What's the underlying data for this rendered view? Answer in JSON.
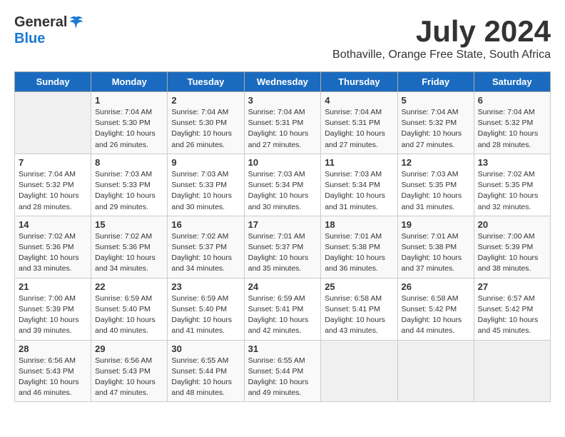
{
  "logo": {
    "general": "General",
    "blue": "Blue"
  },
  "title": "July 2024",
  "subtitle": "Bothaville, Orange Free State, South Africa",
  "days_of_week": [
    "Sunday",
    "Monday",
    "Tuesday",
    "Wednesday",
    "Thursday",
    "Friday",
    "Saturday"
  ],
  "weeks": [
    [
      {
        "day": "",
        "info": ""
      },
      {
        "day": "1",
        "info": "Sunrise: 7:04 AM\nSunset: 5:30 PM\nDaylight: 10 hours\nand 26 minutes."
      },
      {
        "day": "2",
        "info": "Sunrise: 7:04 AM\nSunset: 5:30 PM\nDaylight: 10 hours\nand 26 minutes."
      },
      {
        "day": "3",
        "info": "Sunrise: 7:04 AM\nSunset: 5:31 PM\nDaylight: 10 hours\nand 27 minutes."
      },
      {
        "day": "4",
        "info": "Sunrise: 7:04 AM\nSunset: 5:31 PM\nDaylight: 10 hours\nand 27 minutes."
      },
      {
        "day": "5",
        "info": "Sunrise: 7:04 AM\nSunset: 5:32 PM\nDaylight: 10 hours\nand 27 minutes."
      },
      {
        "day": "6",
        "info": "Sunrise: 7:04 AM\nSunset: 5:32 PM\nDaylight: 10 hours\nand 28 minutes."
      }
    ],
    [
      {
        "day": "7",
        "info": "Sunrise: 7:04 AM\nSunset: 5:32 PM\nDaylight: 10 hours\nand 28 minutes."
      },
      {
        "day": "8",
        "info": "Sunrise: 7:03 AM\nSunset: 5:33 PM\nDaylight: 10 hours\nand 29 minutes."
      },
      {
        "day": "9",
        "info": "Sunrise: 7:03 AM\nSunset: 5:33 PM\nDaylight: 10 hours\nand 30 minutes."
      },
      {
        "day": "10",
        "info": "Sunrise: 7:03 AM\nSunset: 5:34 PM\nDaylight: 10 hours\nand 30 minutes."
      },
      {
        "day": "11",
        "info": "Sunrise: 7:03 AM\nSunset: 5:34 PM\nDaylight: 10 hours\nand 31 minutes."
      },
      {
        "day": "12",
        "info": "Sunrise: 7:03 AM\nSunset: 5:35 PM\nDaylight: 10 hours\nand 31 minutes."
      },
      {
        "day": "13",
        "info": "Sunrise: 7:02 AM\nSunset: 5:35 PM\nDaylight: 10 hours\nand 32 minutes."
      }
    ],
    [
      {
        "day": "14",
        "info": "Sunrise: 7:02 AM\nSunset: 5:36 PM\nDaylight: 10 hours\nand 33 minutes."
      },
      {
        "day": "15",
        "info": "Sunrise: 7:02 AM\nSunset: 5:36 PM\nDaylight: 10 hours\nand 34 minutes."
      },
      {
        "day": "16",
        "info": "Sunrise: 7:02 AM\nSunset: 5:37 PM\nDaylight: 10 hours\nand 34 minutes."
      },
      {
        "day": "17",
        "info": "Sunrise: 7:01 AM\nSunset: 5:37 PM\nDaylight: 10 hours\nand 35 minutes."
      },
      {
        "day": "18",
        "info": "Sunrise: 7:01 AM\nSunset: 5:38 PM\nDaylight: 10 hours\nand 36 minutes."
      },
      {
        "day": "19",
        "info": "Sunrise: 7:01 AM\nSunset: 5:38 PM\nDaylight: 10 hours\nand 37 minutes."
      },
      {
        "day": "20",
        "info": "Sunrise: 7:00 AM\nSunset: 5:39 PM\nDaylight: 10 hours\nand 38 minutes."
      }
    ],
    [
      {
        "day": "21",
        "info": "Sunrise: 7:00 AM\nSunset: 5:39 PM\nDaylight: 10 hours\nand 39 minutes."
      },
      {
        "day": "22",
        "info": "Sunrise: 6:59 AM\nSunset: 5:40 PM\nDaylight: 10 hours\nand 40 minutes."
      },
      {
        "day": "23",
        "info": "Sunrise: 6:59 AM\nSunset: 5:40 PM\nDaylight: 10 hours\nand 41 minutes."
      },
      {
        "day": "24",
        "info": "Sunrise: 6:59 AM\nSunset: 5:41 PM\nDaylight: 10 hours\nand 42 minutes."
      },
      {
        "day": "25",
        "info": "Sunrise: 6:58 AM\nSunset: 5:41 PM\nDaylight: 10 hours\nand 43 minutes."
      },
      {
        "day": "26",
        "info": "Sunrise: 6:58 AM\nSunset: 5:42 PM\nDaylight: 10 hours\nand 44 minutes."
      },
      {
        "day": "27",
        "info": "Sunrise: 6:57 AM\nSunset: 5:42 PM\nDaylight: 10 hours\nand 45 minutes."
      }
    ],
    [
      {
        "day": "28",
        "info": "Sunrise: 6:56 AM\nSunset: 5:43 PM\nDaylight: 10 hours\nand 46 minutes."
      },
      {
        "day": "29",
        "info": "Sunrise: 6:56 AM\nSunset: 5:43 PM\nDaylight: 10 hours\nand 47 minutes."
      },
      {
        "day": "30",
        "info": "Sunrise: 6:55 AM\nSunset: 5:44 PM\nDaylight: 10 hours\nand 48 minutes."
      },
      {
        "day": "31",
        "info": "Sunrise: 6:55 AM\nSunset: 5:44 PM\nDaylight: 10 hours\nand 49 minutes."
      },
      {
        "day": "",
        "info": ""
      },
      {
        "day": "",
        "info": ""
      },
      {
        "day": "",
        "info": ""
      }
    ]
  ]
}
